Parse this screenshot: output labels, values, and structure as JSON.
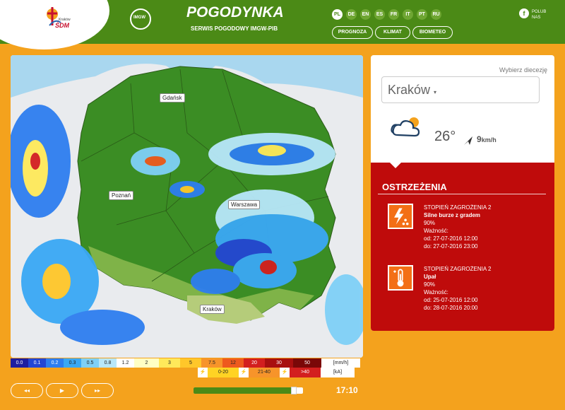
{
  "header": {
    "sdm_small": "Kraków",
    "sdm_text": "ŚDM",
    "imgw_text": "IMGW",
    "brand": "POGODYNKA",
    "brand_sub": "SERWIS POGODOWY IMGW-PIB",
    "languages": [
      "PL",
      "DE",
      "EN",
      "ES",
      "FR",
      "IT",
      "PT",
      "RU"
    ],
    "active_language": "PL",
    "nav": [
      "PROGNOZA",
      "KLIMAT",
      "BIOMETEO"
    ],
    "fb_icon": "f",
    "fb_text_1": "POLUB",
    "fb_text_2": "NAS"
  },
  "map": {
    "cities": [
      "Gdańsk",
      "Poznań",
      "Warszawa",
      "Kraków"
    ]
  },
  "legend": {
    "precip_labels": [
      "0.0",
      "0.1",
      "0.2",
      "0.3",
      "0.5",
      "0.8",
      "1.2",
      "2",
      "3",
      "5",
      "7.5",
      "12",
      "20",
      "30",
      "50",
      "[mm/h]"
    ],
    "precip_colors": [
      "#1e1ea0",
      "#2346d4",
      "#2e7ef0",
      "#3aa8f5",
      "#7fd0f7",
      "#b8e7fa",
      "#ffffff",
      "#ffffc4",
      "#ffe95a",
      "#ffc72a",
      "#f7942a",
      "#ee5a1e",
      "#d31f1f",
      "#a80f0f",
      "#7a0808",
      "#ffffff"
    ],
    "lightning_labels": [
      "0-20",
      "21-40",
      ">40",
      "[kA]"
    ],
    "lightning_colors": [
      "#ffd324",
      "#f7942a",
      "#d31f1f",
      "#ffffff"
    ],
    "lightning_icon": "⚡"
  },
  "controls": {
    "rewind": "◂◂",
    "play": "▶",
    "forward": "▸▸",
    "progress": 0.94,
    "time": "17:10"
  },
  "side": {
    "diocese_label": "Wybierz diecezję",
    "diocese_value": "Kraków",
    "caret": "▾",
    "temperature": "26°",
    "wind_value": "9",
    "wind_unit": "km/h",
    "alerts_title": "OSTRZEŻENIA",
    "alerts": [
      {
        "level": "STOPIEŃ ZAGROŻENIA 2",
        "name": "Silne burze z gradem",
        "probability": "90%",
        "validity_label": "Ważność:",
        "from": "od: 27-07-2016 12:00",
        "to": "do: 27-07-2016 23:00",
        "icon": "storm-hail-icon"
      },
      {
        "level": "STOPIEŃ ZAGROŻENIA 2",
        "name": "Upał",
        "probability": "90%",
        "validity_label": "Ważność:",
        "from": "od: 25-07-2016 12:00",
        "to": "do: 28-07-2016 20:00",
        "icon": "thermometer-icon"
      }
    ]
  }
}
